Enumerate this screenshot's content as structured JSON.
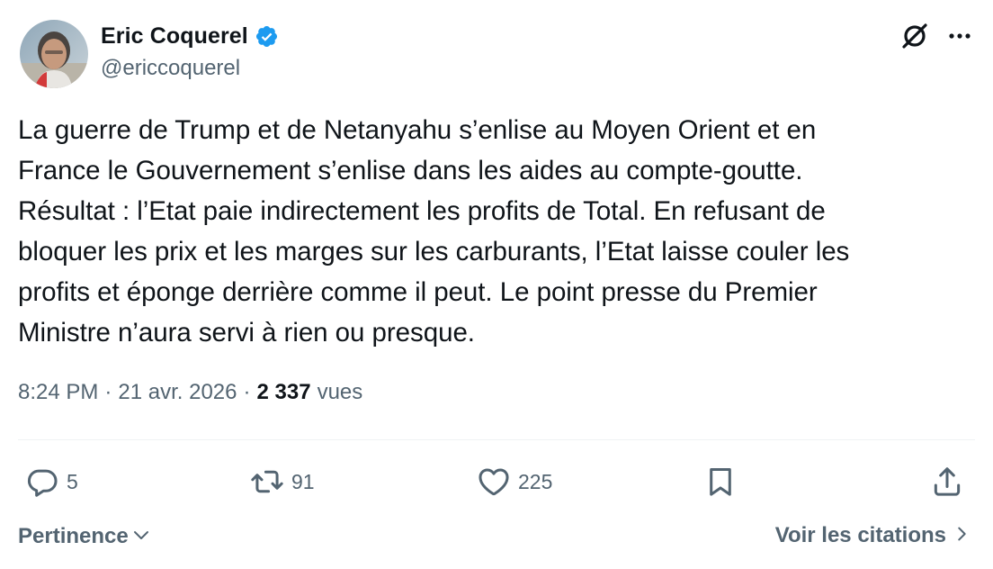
{
  "author": {
    "display_name": "Eric Coquerel",
    "handle": "@ericcoquerel",
    "verified": true,
    "avatar": "user-avatar-photo"
  },
  "header_icons": [
    "grok-icon",
    "more-icon"
  ],
  "tweet": {
    "text": "La guerre de Trump et de Netanyahu s’enlise au Moyen Orient et en\nFrance le Gouvernement s’enlise dans les aides au compte-goutte.\nRésultat : l’Etat paie indirectement les profits de Total. En refusant de\nbloquer les prix et les marges sur les carburants, l’Etat laisse couler les\nprofits et éponge derrière comme il peut. Le point presse du Premier\nMinistre n’aura servi à rien ou presque.",
    "time": "8:24 PM",
    "date": "21 avr. 2026",
    "separator": "·",
    "views_count": "2 337",
    "views_label": "vues"
  },
  "actions": {
    "replies": "5",
    "retweets": "91",
    "likes": "225"
  },
  "footer": {
    "sort_label": "Pertinence",
    "quotes_label": "Voir les citations"
  },
  "colors": {
    "text_primary": "#0f1419",
    "text_secondary": "#536471",
    "verified_blue": "#1d9bf0",
    "divider": "#eff3f4"
  }
}
